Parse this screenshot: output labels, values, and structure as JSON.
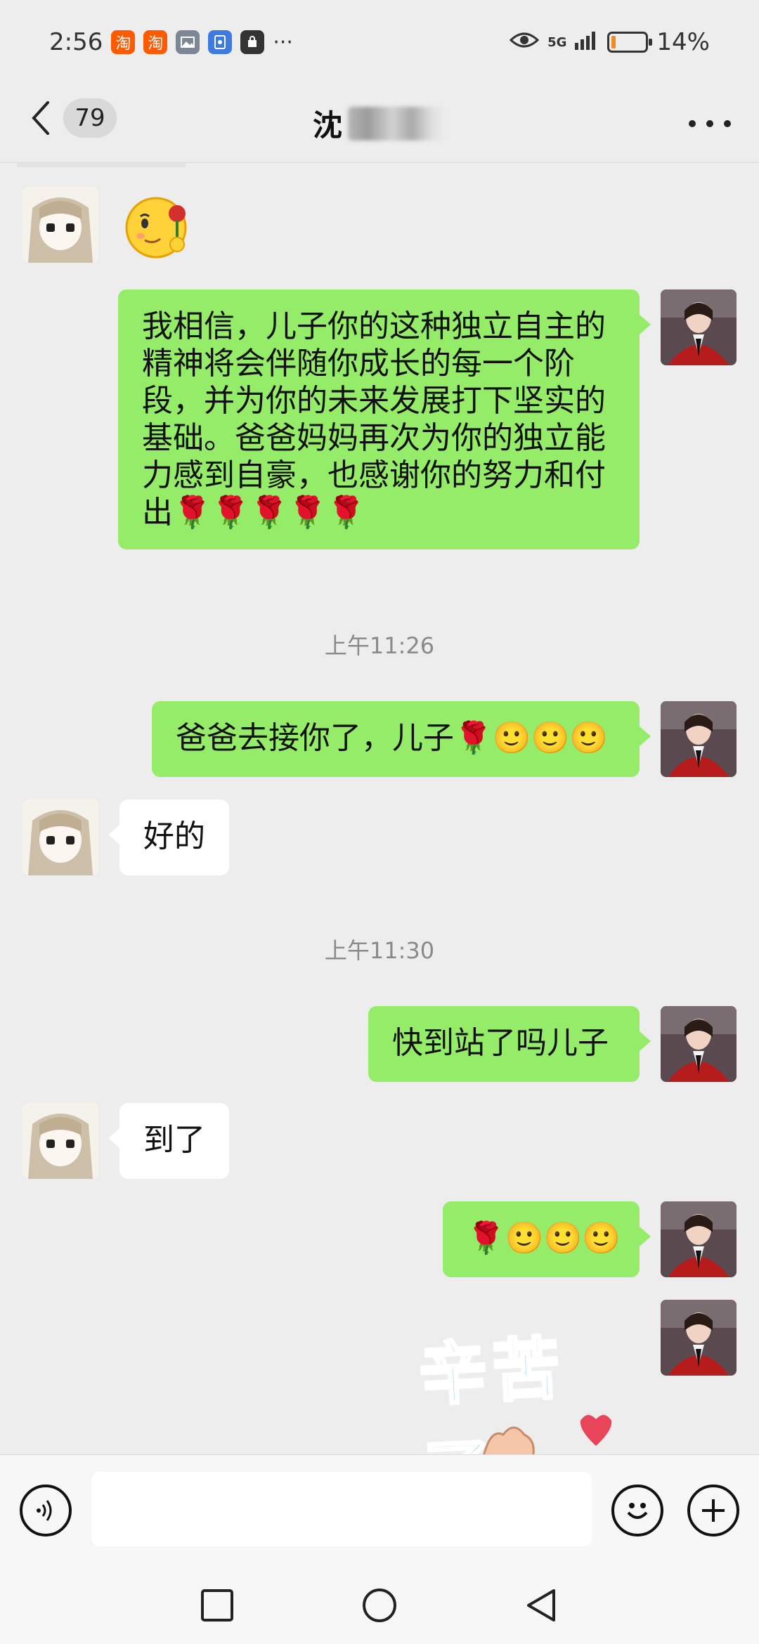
{
  "status_bar": {
    "time": "2:56",
    "app_icons": [
      "淘",
      "淘"
    ],
    "more": "···",
    "network": "5G",
    "battery_percent": "14%",
    "battery_level": 0.14
  },
  "header": {
    "unread_count": "79",
    "title": "沈"
  },
  "messages": [
    {
      "side": "right",
      "text": "我相信，儿子你的这种独立自主的精神将会伴随你成长的每一个阶段，并为你的未来发展打下坚实的基础。爸爸妈妈再次为你的独立能力感到自豪，也感谢你的努力和付出",
      "emoji": "🌹🌹🌹🌹🌹"
    },
    {
      "side": "timestamp",
      "text": "上午11:26"
    },
    {
      "side": "right",
      "text": "爸爸去接你了，儿子",
      "emoji": "🌹🙂🙂🙂"
    },
    {
      "side": "left",
      "text": "好的"
    },
    {
      "side": "timestamp",
      "text": "上午11:30"
    },
    {
      "side": "right",
      "text": "快到站了吗儿子"
    },
    {
      "side": "left",
      "text": "到了"
    },
    {
      "side": "right",
      "text": "",
      "emoji": "🌹🙂🙂🙂"
    },
    {
      "side": "right-sticker",
      "text": "辛苦了"
    }
  ],
  "input_bar": {
    "placeholder": ""
  },
  "colors": {
    "bubble_right": "#95ec69",
    "bubble_left": "#ffffff",
    "background": "#ededed",
    "sticker_text": "#5aa9e6",
    "battery_fill": "#f08a24"
  }
}
